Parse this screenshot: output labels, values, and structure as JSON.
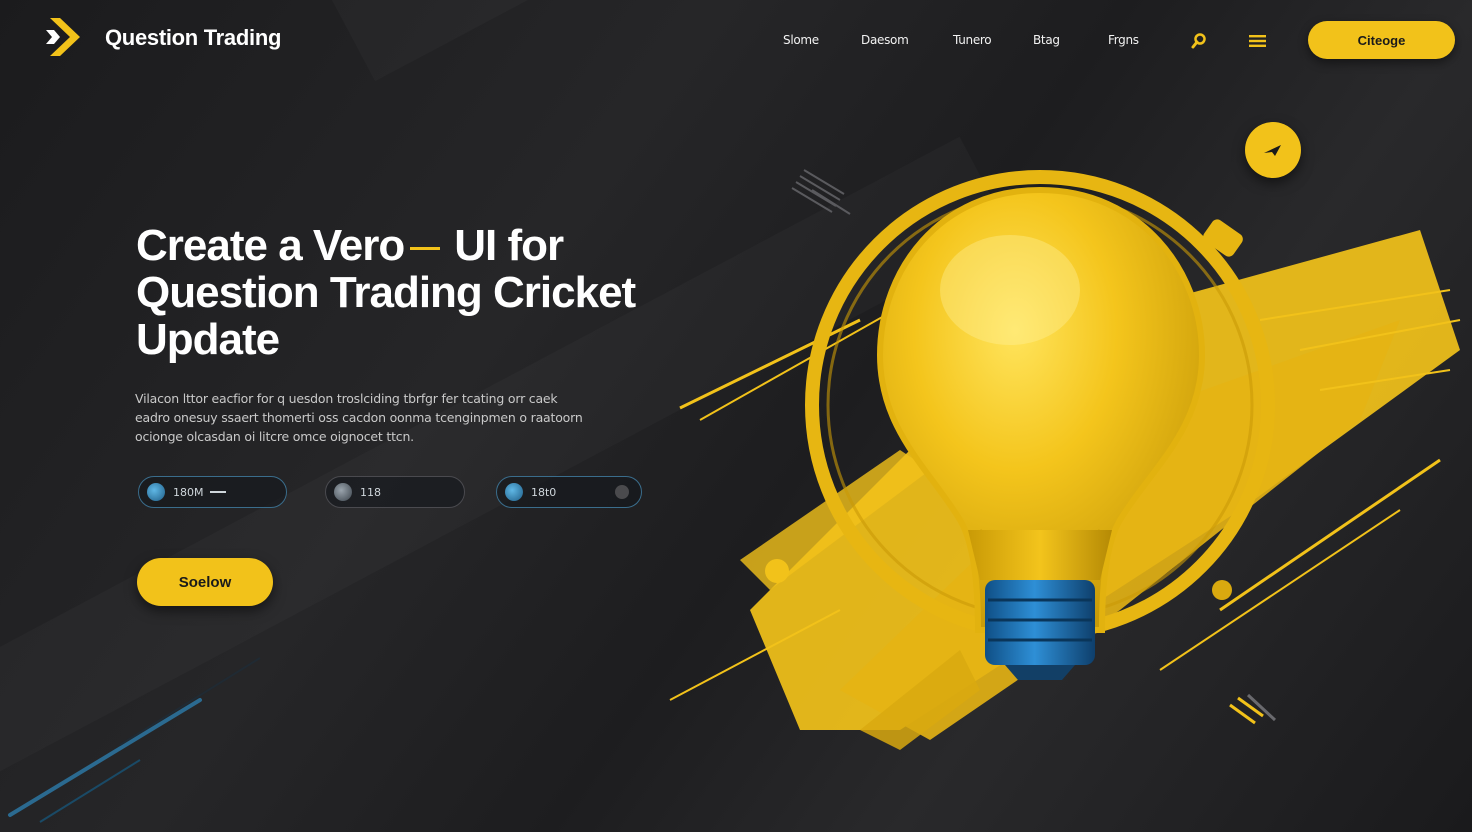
{
  "brand": {
    "name": "Question Trading",
    "logo_icon": "chevron-logo-icon"
  },
  "nav": {
    "items": [
      {
        "label": "Slome"
      },
      {
        "label": "Daesom"
      },
      {
        "label": "Tunero"
      },
      {
        "label": "Btag"
      },
      {
        "label": "Frgns"
      }
    ],
    "search_icon": "search-icon",
    "menu_icon": "hamburger-menu-icon",
    "cta_label": "Citeoge"
  },
  "hero": {
    "title_part1": "Create a Vero",
    "title_part2": "UI for",
    "title_line2": "Question Trading Cricket",
    "title_line3": "Update",
    "description": "Vilacon lttor eacfior for q uesdon troslciding tbrfgr fer tcating orr caek eadro onesuy ssaert thomerti oss cacdon oonma tcenginpmen o raatoorn ocionge olcasdan oi litcre omce oignocet ttcn.",
    "stats": [
      {
        "value": "180M",
        "icon": "cricket-ball-icon"
      },
      {
        "value": "118",
        "icon": "cricket-ball-icon"
      },
      {
        "value": "18t0",
        "icon": "globe-icon"
      }
    ],
    "primary_button": "Soelow"
  },
  "floating_button_icon": "send-arrow-icon",
  "illustration_icon": "lightbulb-icon",
  "colors": {
    "accent": "#f2c21a",
    "background": "#1f1f21",
    "secondary": "#2e7fc1"
  }
}
